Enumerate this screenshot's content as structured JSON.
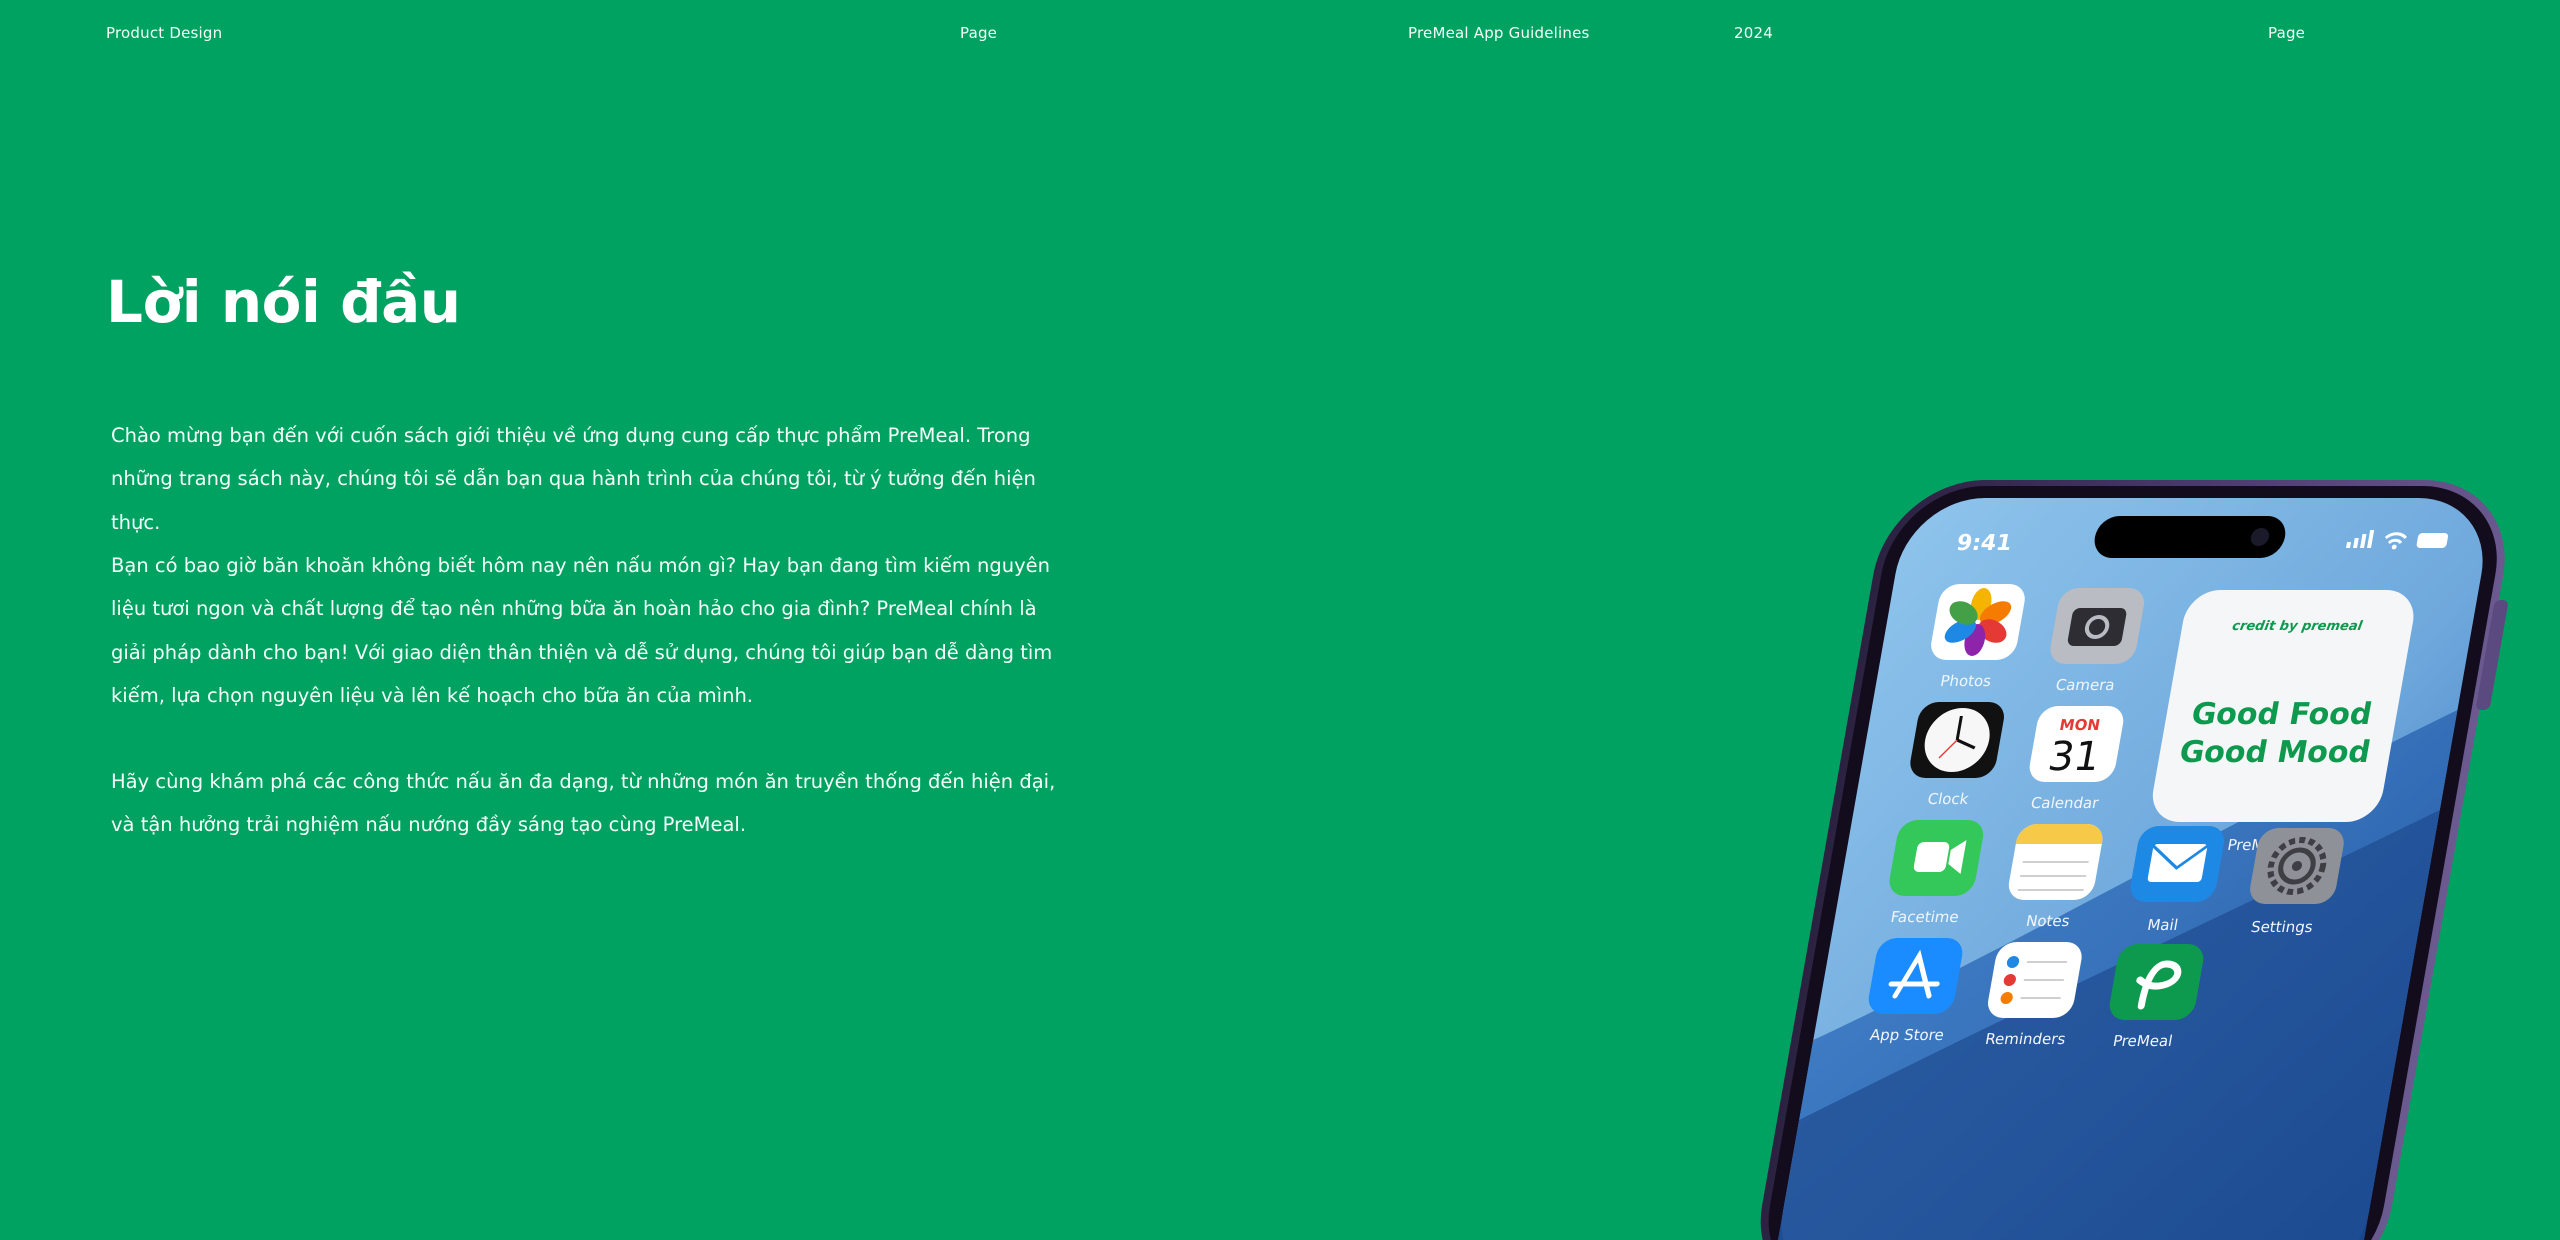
{
  "header": {
    "left": "Product Design",
    "page_left": "Page",
    "guide": "PreMeal App Guidelines",
    "year": "2024",
    "page_right": "Page"
  },
  "title": "Lời nói đầu",
  "paragraphs": [
    "Chào mừng bạn đến với cuốn sách giới thiệu về ứng dụng cung cấp thực phẩm PreMeal. Trong những trang sách này, chúng tôi sẽ dẫn bạn qua hành trình của chúng tôi, từ ý tưởng đến hiện thực.",
    "Bạn có bao giờ băn khoăn không biết hôm nay nên nấu món gì? Hay bạn đang tìm kiếm nguyên liệu tươi ngon và chất lượng để tạo nên những bữa ăn hoàn hảo cho gia đình? PreMeal chính là giải pháp dành cho bạn! Với giao diện thân thiện và dễ sử dụng, chúng tôi giúp bạn dễ dàng tìm kiếm, lựa chọn nguyên liệu và lên kế hoạch cho bữa ăn của mình.",
    "Hãy cùng khám phá các công thức nấu ăn đa dạng, từ những món ăn truyền thống đến hiện đại, và tận hưởng trải nghiệm nấu nướng đầy sáng tạo cùng PreMeal."
  ],
  "phone": {
    "time": "9:41",
    "widget": {
      "credit": "credit by premeal",
      "line1": "Good Food",
      "line2": "Good Mood",
      "label": "PreMeal"
    },
    "calendar": {
      "month": "MON",
      "day": "31"
    },
    "apps": {
      "photos": "Photos",
      "camera": "Camera",
      "clock": "Clock",
      "calendar": "Calendar",
      "facetime": "Facetime",
      "notes": "Notes",
      "mail": "Mail",
      "settings": "Settings",
      "appstore": "App Store",
      "reminders": "Reminders",
      "premeal": "PreMeal"
    }
  },
  "colors": {
    "background": "#00a262",
    "phone_frame": "#4a3a6e",
    "brand_green": "#0e9a4e"
  }
}
